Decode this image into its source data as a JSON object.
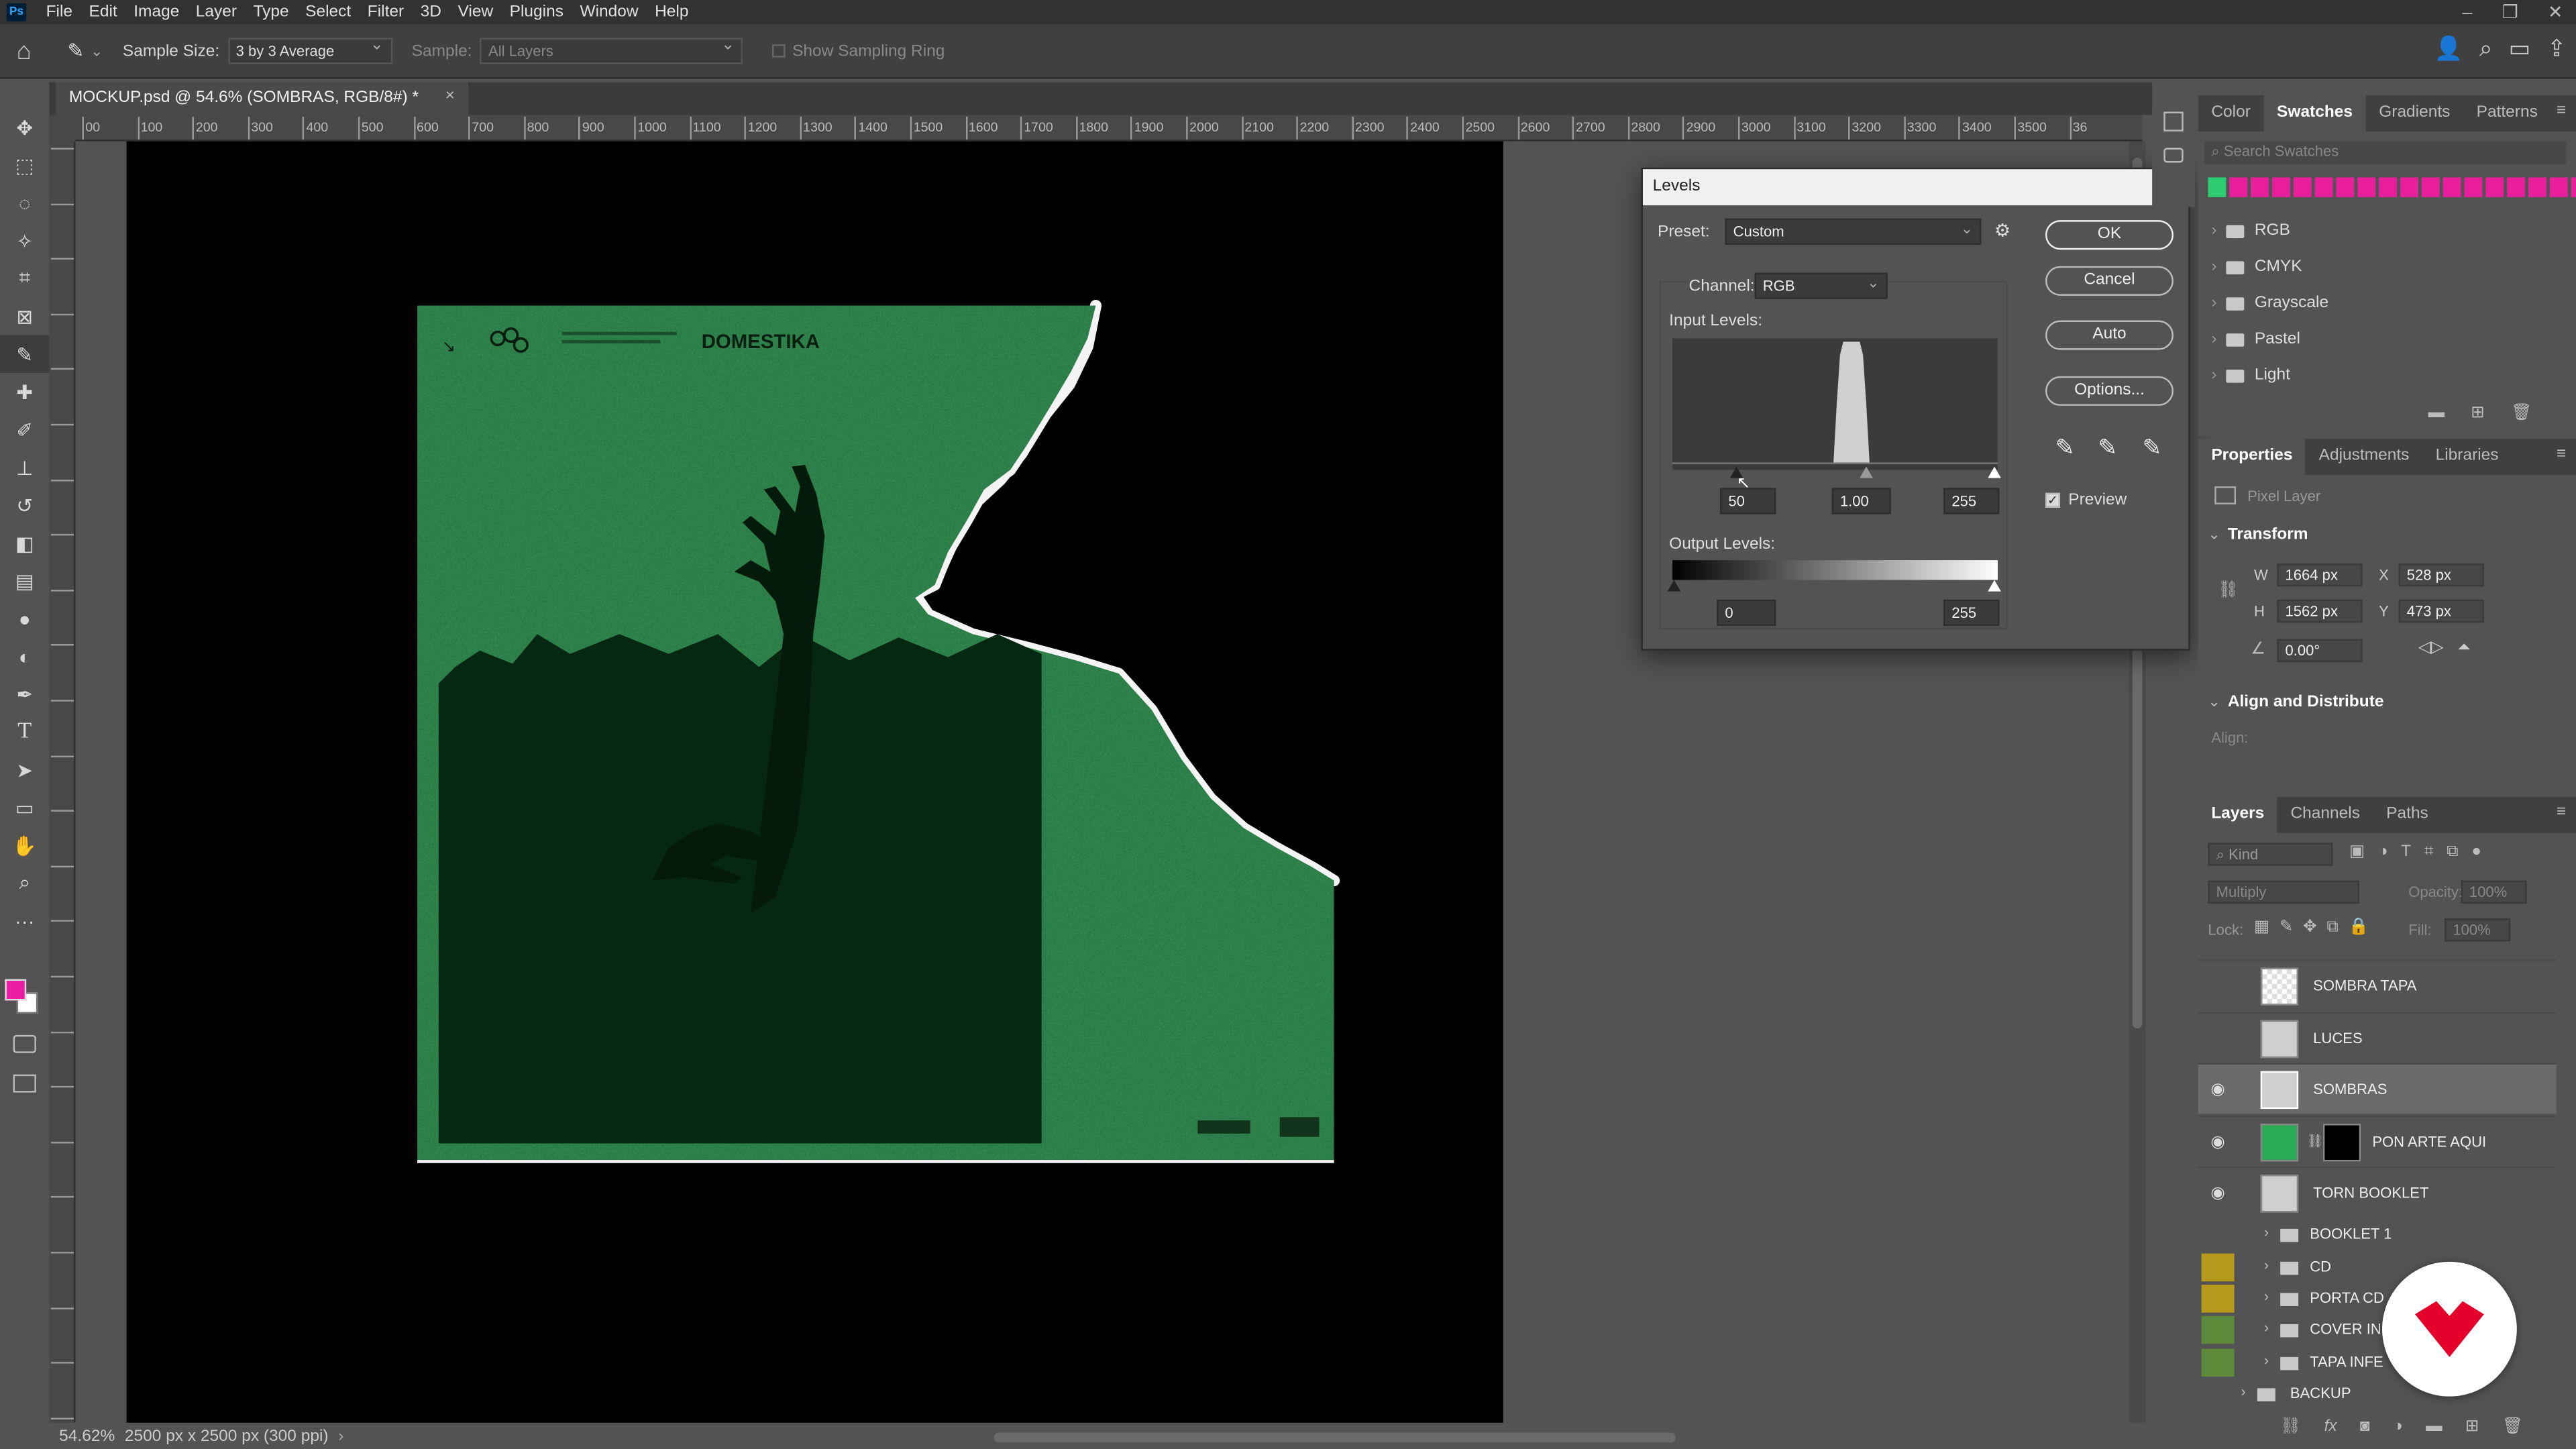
{
  "menu": {
    "logo": "Ps",
    "items": [
      "File",
      "Edit",
      "Image",
      "Layer",
      "Type",
      "Select",
      "Filter",
      "3D",
      "View",
      "Plugins",
      "Window",
      "Help"
    ]
  },
  "options_bar": {
    "sample_size_label": "Sample Size:",
    "sample_size_value": "3 by 3 Average",
    "sample_label": "Sample:",
    "sample_value": "All Layers",
    "show_ring_label": "Show Sampling Ring"
  },
  "document": {
    "tab_title": "MOCKUP.psd @ 54.6% (SOMBRAS, RGB/8#) *",
    "artwork_brand": "DOMESTIKA"
  },
  "ruler": {
    "marks": [
      "00",
      "100",
      "200",
      "300",
      "400",
      "500",
      "600",
      "700",
      "800",
      "900",
      "1000",
      "1100",
      "1200",
      "1300",
      "1400",
      "1500",
      "1600",
      "1700",
      "1800",
      "1900",
      "2000",
      "2100",
      "2200",
      "2300",
      "2400",
      "2500",
      "2600",
      "2700",
      "2800",
      "2900",
      "3000",
      "3100",
      "3200",
      "3300",
      "3400",
      "3500",
      "36"
    ]
  },
  "status": {
    "zoom": "54.62%",
    "doc_info": "2500 px x 2500 px (300 ppi)"
  },
  "levels_dialog": {
    "title": "Levels",
    "preset_label": "Preset:",
    "preset_value": "Custom",
    "channel_label": "Channel:",
    "channel_value": "RGB",
    "input_levels_label": "Input Levels:",
    "input_black": "50",
    "input_gamma": "1.00",
    "input_white": "255",
    "output_levels_label": "Output Levels:",
    "output_black": "0",
    "output_white": "255",
    "ok": "OK",
    "cancel": "Cancel",
    "auto": "Auto",
    "options": "Options...",
    "preview_label": "Preview",
    "preview_checked": true
  },
  "swatches_panel": {
    "tabs": [
      "Color",
      "Swatches",
      "Gradients",
      "Patterns"
    ],
    "active_tab": "Swatches",
    "search_placeholder": "Search Swatches",
    "recent_colors": [
      "#2ecc71",
      "#e91e9c",
      "#e91e9c",
      "#e91e9c",
      "#e91e9c",
      "#e91e9c",
      "#e91e9c",
      "#e91e9c",
      "#e91e9c",
      "#e91e9c",
      "#e91e9c",
      "#e91e9c",
      "#e91e9c",
      "#e91e9c",
      "#e91e9c",
      "#e91e9c",
      "#e91e9c",
      "#e91e9c"
    ],
    "folders": [
      "RGB",
      "CMYK",
      "Grayscale",
      "Pastel",
      "Light"
    ]
  },
  "properties_panel": {
    "tabs": [
      "Properties",
      "Adjustments",
      "Libraries"
    ],
    "active_tab": "Properties",
    "layer_type": "Pixel Layer",
    "transform_title": "Transform",
    "w": "1664 px",
    "h": "1562 px",
    "x": "528 px",
    "y": "473 px",
    "angle": "0.00°",
    "w_label": "W",
    "h_label": "H",
    "x_label": "X",
    "y_label": "Y",
    "align_title": "Align and Distribute",
    "align_label": "Align:"
  },
  "layers_panel": {
    "tabs": [
      "Layers",
      "Channels",
      "Paths"
    ],
    "active_tab": "Layers",
    "kind_placeholder": "Kind",
    "blend_mode": "Multiply",
    "opacity_label": "Opacity:",
    "opacity_value": "100%",
    "lock_label": "Lock:",
    "fill_label": "Fill:",
    "fill_value": "100%",
    "layers": [
      {
        "name": "SOMBRA TAPA",
        "visible": false,
        "selected": false
      },
      {
        "name": "LUCES",
        "visible": false,
        "selected": false
      },
      {
        "name": "SOMBRAS",
        "visible": true,
        "selected": true
      },
      {
        "name": "PON ARTE AQUI",
        "visible": true,
        "selected": false
      },
      {
        "name": "TORN BOOKLET",
        "visible": true,
        "selected": false
      }
    ],
    "groups": [
      {
        "name": "BOOKLET 1",
        "color": "#535353"
      },
      {
        "name": "CD",
        "color": "#b59a1d"
      },
      {
        "name": "PORTA CD",
        "color": "#b59a1d"
      },
      {
        "name": "COVER IN",
        "color": "#5c8a3a"
      },
      {
        "name": "TAPA INFE",
        "color": "#5c8a3a"
      },
      {
        "name": "BACKUP",
        "color": "#535353"
      }
    ]
  },
  "colors": {
    "foreground": "#ea1ea0",
    "background": "#ffffff",
    "artwork_green": "#1f7a3e"
  }
}
